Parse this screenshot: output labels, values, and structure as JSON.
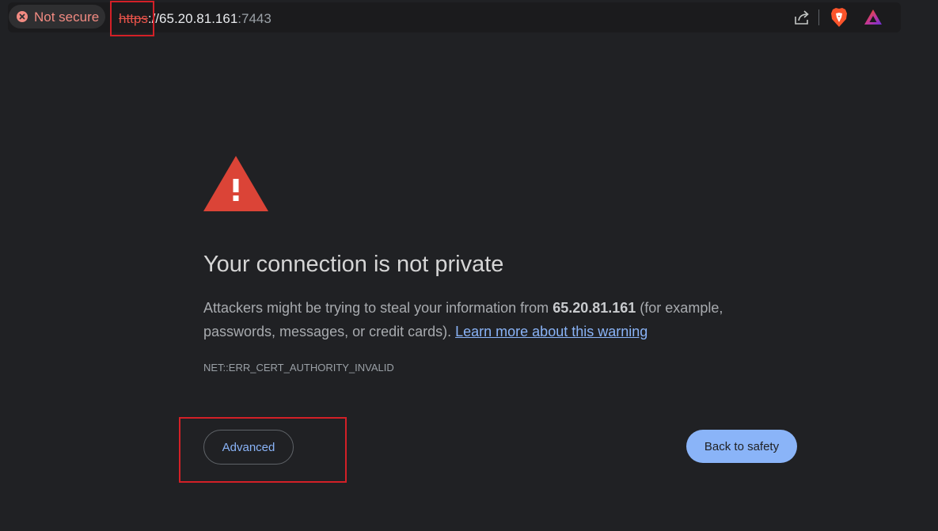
{
  "address_bar": {
    "security_label": "Not secure",
    "url_scheme": "https",
    "url_separator": "://",
    "url_host": "65.20.81.161",
    "url_port": ":7443"
  },
  "toolbar_icons": [
    "share-icon",
    "brave-shields-icon",
    "brave-rewards-icon"
  ],
  "interstitial": {
    "heading": "Your connection is not private",
    "body_before": "Attackers might be trying to steal your information from ",
    "body_host": "65.20.81.161",
    "body_after": " (for example, passwords, messages, or credit cards). ",
    "learn_more_link": "Learn more about this warning",
    "error_code": "NET::ERR_CERT_AUTHORITY_INVALID",
    "advanced_button": "Advanced",
    "back_button": "Back to safety"
  },
  "colors": {
    "background": "#202124",
    "warning_red": "#db4437",
    "link_blue": "#8ab4f8",
    "highlight_box": "#d32027"
  }
}
